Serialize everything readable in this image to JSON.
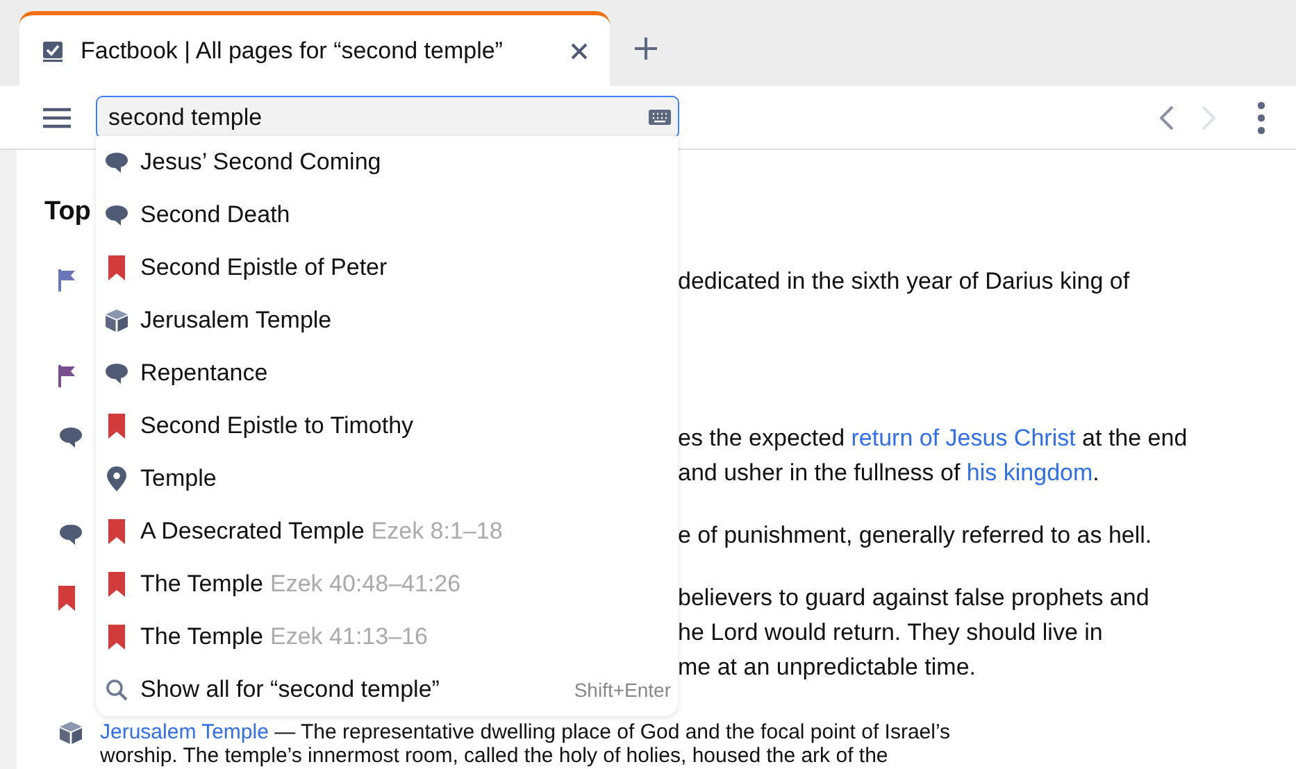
{
  "tab": {
    "title": "Factbook | All pages for “second temple”",
    "selected": true
  },
  "search": {
    "value": "second temple"
  },
  "suggestions": [
    {
      "kind": "topic",
      "label": "Jesus’ Second Coming"
    },
    {
      "kind": "topic",
      "label": "Second Death"
    },
    {
      "kind": "passage",
      "label": "Second Epistle of Peter"
    },
    {
      "kind": "thing",
      "label": "Jerusalem Temple"
    },
    {
      "kind": "topic",
      "label": "Repentance"
    },
    {
      "kind": "passage",
      "label": "Second Epistle to Timothy"
    },
    {
      "kind": "place",
      "label": "Temple"
    },
    {
      "kind": "passage",
      "label": "A Desecrated Temple",
      "reference": "Ezek 8:1–18"
    },
    {
      "kind": "passage",
      "label": "The Temple",
      "reference": "Ezek 40:48–41:26"
    },
    {
      "kind": "passage",
      "label": "The Temple",
      "reference": "Ezek 41:13–16"
    }
  ],
  "show_all": {
    "label": "Show all for “second temple”",
    "shortcut": "Shift+Enter"
  },
  "heading": "Top",
  "entries": [
    {
      "kind": "flag",
      "color": "#6b76b8",
      "hidden_start": true,
      "lines": [
        [
          {
            "text": "dedicated in the sixth year of Darius king of",
            "link": false
          }
        ]
      ]
    },
    {
      "kind": "flag",
      "color": "#7a4f8e",
      "hidden_start": true
    },
    {
      "kind": "topic",
      "hidden_start": true,
      "lines": [
        [
          {
            "text": "es the expected ",
            "link": false
          },
          {
            "text": "return of Jesus Christ",
            "link": true
          },
          {
            "text": " at the end",
            "link": false
          }
        ],
        [
          {
            "text": "and usher in the fullness of ",
            "link": false
          },
          {
            "text": "his kingdom",
            "link": true
          },
          {
            "text": ".",
            "link": false
          }
        ]
      ]
    },
    {
      "kind": "topic",
      "hidden_start": true,
      "lines": [
        [
          {
            "text": "e of punishment, generally referred to as hell.",
            "link": false
          }
        ]
      ]
    },
    {
      "kind": "passage",
      "hidden_start": true,
      "lines": [
        [
          {
            "text": "believers to guard against false prophets and",
            "link": false
          }
        ],
        [
          {
            "text": "he Lord would return. They should live in",
            "link": false
          }
        ],
        [
          {
            "text": "me at an unpredictable time.",
            "link": false
          }
        ]
      ]
    },
    {
      "kind": "thing",
      "hidden_start": false,
      "lines": [
        [
          {
            "text": "Jerusalem Temple",
            "link": true
          },
          {
            "text": " — The representative dwelling place of God and the focal point of Israel’s",
            "link": false
          }
        ],
        [
          {
            "text": "worship. The temple’s innermost room, called the holy of holies, housed the ark of the",
            "link": false
          }
        ]
      ]
    }
  ]
}
